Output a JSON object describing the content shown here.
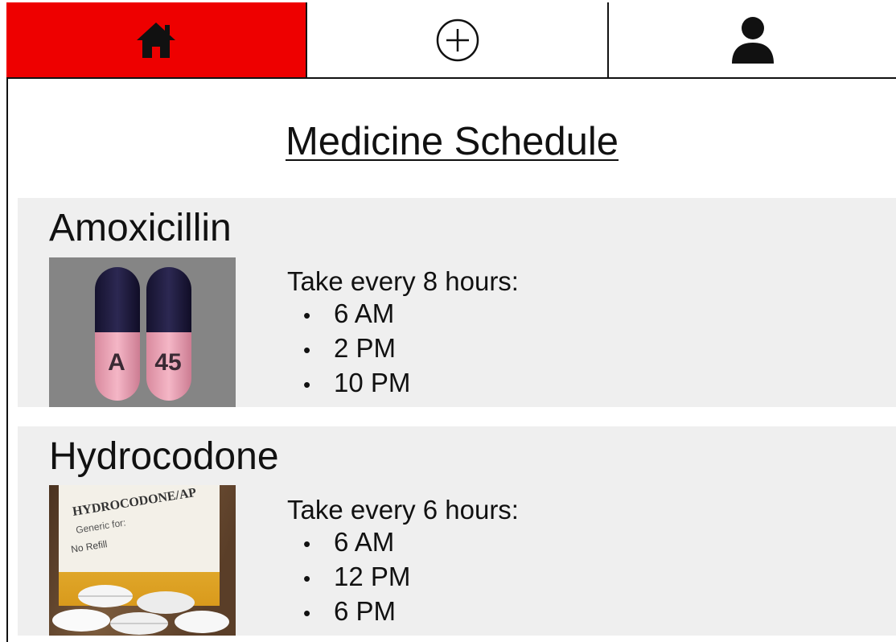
{
  "colors": {
    "accent": "#ee0000",
    "card_bg": "#efefef"
  },
  "nav": {
    "tabs": [
      {
        "icon": "home-icon",
        "active": true
      },
      {
        "icon": "plus-circle-icon",
        "active": false
      },
      {
        "icon": "user-icon",
        "active": false
      }
    ]
  },
  "page": {
    "title": "Medicine Schedule"
  },
  "medicines": [
    {
      "name": "Amoxicillin",
      "pill_imprint_left": "A",
      "pill_imprint_right": "45",
      "frequency": "Take every 8 hours:",
      "times": [
        "6 AM",
        "2 PM",
        "10 PM"
      ]
    },
    {
      "name": "Hydrocodone",
      "label_drug": "HYDROCODONE/AP",
      "label_generic": "Generic for:",
      "label_refill": "No Refill",
      "frequency": "Take every 6 hours:",
      "times": [
        "6 AM",
        "12 PM",
        "6 PM"
      ]
    }
  ]
}
